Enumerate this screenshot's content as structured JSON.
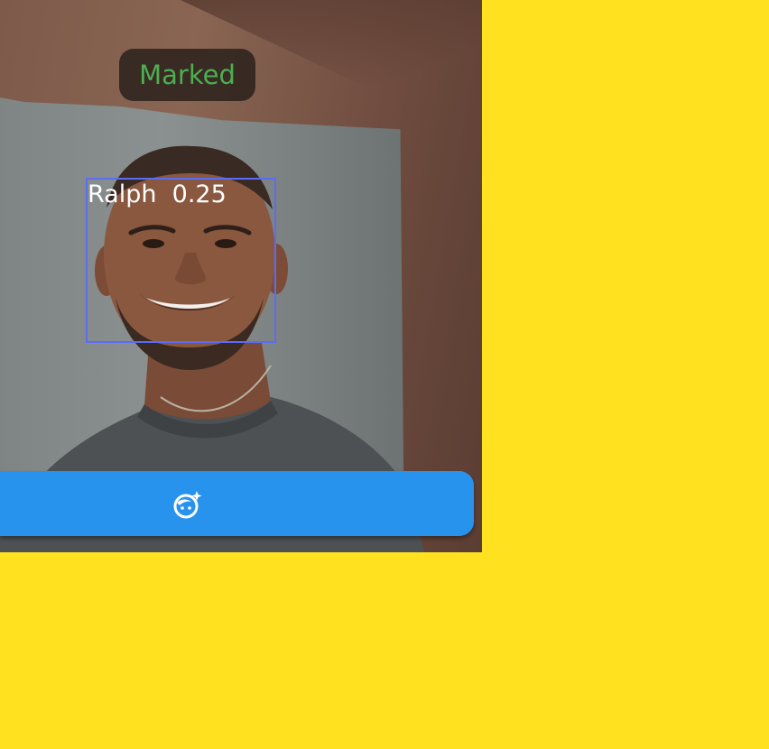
{
  "status": {
    "label": "Marked",
    "color": "#4CAF50"
  },
  "detection": {
    "name": "Ralph",
    "score": "0.25",
    "box_color": "#5B6CF5"
  },
  "action_bar": {
    "icon": "face-retouching-icon",
    "color": "#2893ED"
  },
  "background_color": "#FFE11F"
}
